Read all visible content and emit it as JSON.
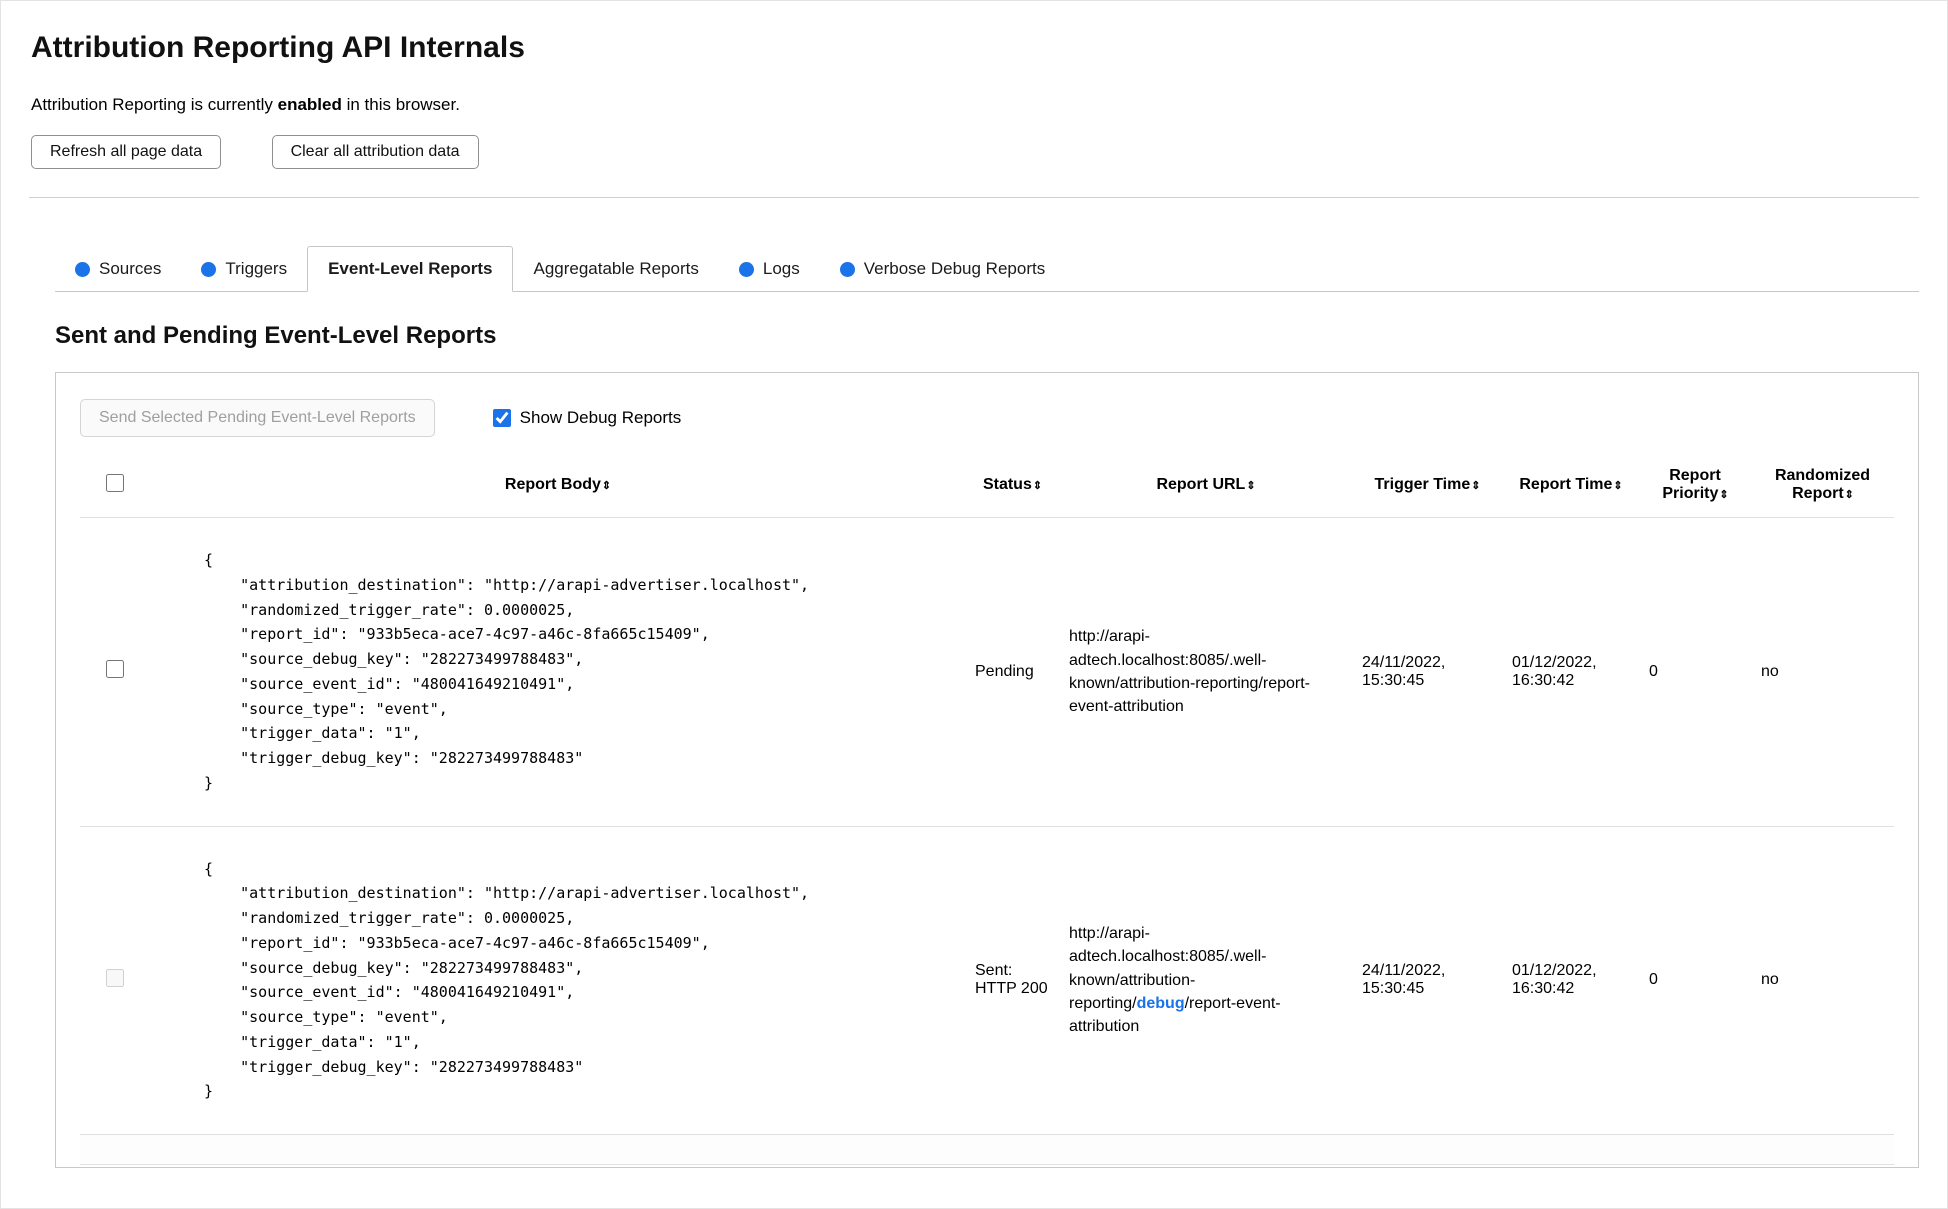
{
  "page": {
    "title": "Attribution Reporting API Internals",
    "status": {
      "prefix": "Attribution Reporting is currently ",
      "emphasis": "enabled",
      "suffix": " in this browser."
    },
    "buttons": {
      "refresh": "Refresh all page data",
      "clear": "Clear all attribution data"
    }
  },
  "colors": {
    "accent_blue": "#1a73e8",
    "link_blue": "#1a73e8"
  },
  "tabs": [
    {
      "label": "Sources",
      "has_dot": true,
      "active": false
    },
    {
      "label": "Triggers",
      "has_dot": true,
      "active": false
    },
    {
      "label": "Event-Level Reports",
      "has_dot": false,
      "active": true
    },
    {
      "label": "Aggregatable Reports",
      "has_dot": false,
      "active": false
    },
    {
      "label": "Logs",
      "has_dot": true,
      "active": false
    },
    {
      "label": "Verbose Debug Reports",
      "has_dot": true,
      "active": false
    }
  ],
  "section": {
    "heading": "Sent and Pending Event-Level Reports",
    "send_button": "Send Selected Pending Event-Level Reports",
    "show_debug_label": "Show Debug Reports"
  },
  "table": {
    "sort_glyph": "⇕",
    "headers": {
      "body": "Report Body",
      "status": "Status",
      "url": "Report URL",
      "trigger_time": "Trigger Time",
      "report_time": "Report Time",
      "priority": "Report Priority",
      "randomized": "Randomized Report"
    },
    "rows": [
      {
        "body": "{\n    \"attribution_destination\": \"http://arapi-advertiser.localhost\",\n    \"randomized_trigger_rate\": 0.0000025,\n    \"report_id\": \"933b5eca-ace7-4c97-a46c-8fa665c15409\",\n    \"source_debug_key\": \"282273499788483\",\n    \"source_event_id\": \"480041649210491\",\n    \"source_type\": \"event\",\n    \"trigger_data\": \"1\",\n    \"trigger_debug_key\": \"282273499788483\"\n}",
        "status": "Pending",
        "url": "http://arapi-adtech.localhost:8085/.well-known/attribution-reporting/report-event-attribution",
        "trigger_time": "24/11/2022, 15:30:45",
        "report_time": "01/12/2022, 16:30:42",
        "priority": "0",
        "randomized": "no"
      },
      {
        "body": "{\n    \"attribution_destination\": \"http://arapi-advertiser.localhost\",\n    \"randomized_trigger_rate\": 0.0000025,\n    \"report_id\": \"933b5eca-ace7-4c97-a46c-8fa665c15409\",\n    \"source_debug_key\": \"282273499788483\",\n    \"source_event_id\": \"480041649210491\",\n    \"source_type\": \"event\",\n    \"trigger_data\": \"1\",\n    \"trigger_debug_key\": \"282273499788483\"\n}",
        "status": "Sent: HTTP 200",
        "url_prefix": "http://arapi-adtech.localhost:8085/.well-known/attribution-reporting/",
        "url_link": "debug",
        "url_suffix": "/report-event-attribution",
        "trigger_time": "24/11/2022, 15:30:45",
        "report_time": "01/12/2022, 16:30:42",
        "priority": "0",
        "randomized": "no"
      }
    ]
  }
}
